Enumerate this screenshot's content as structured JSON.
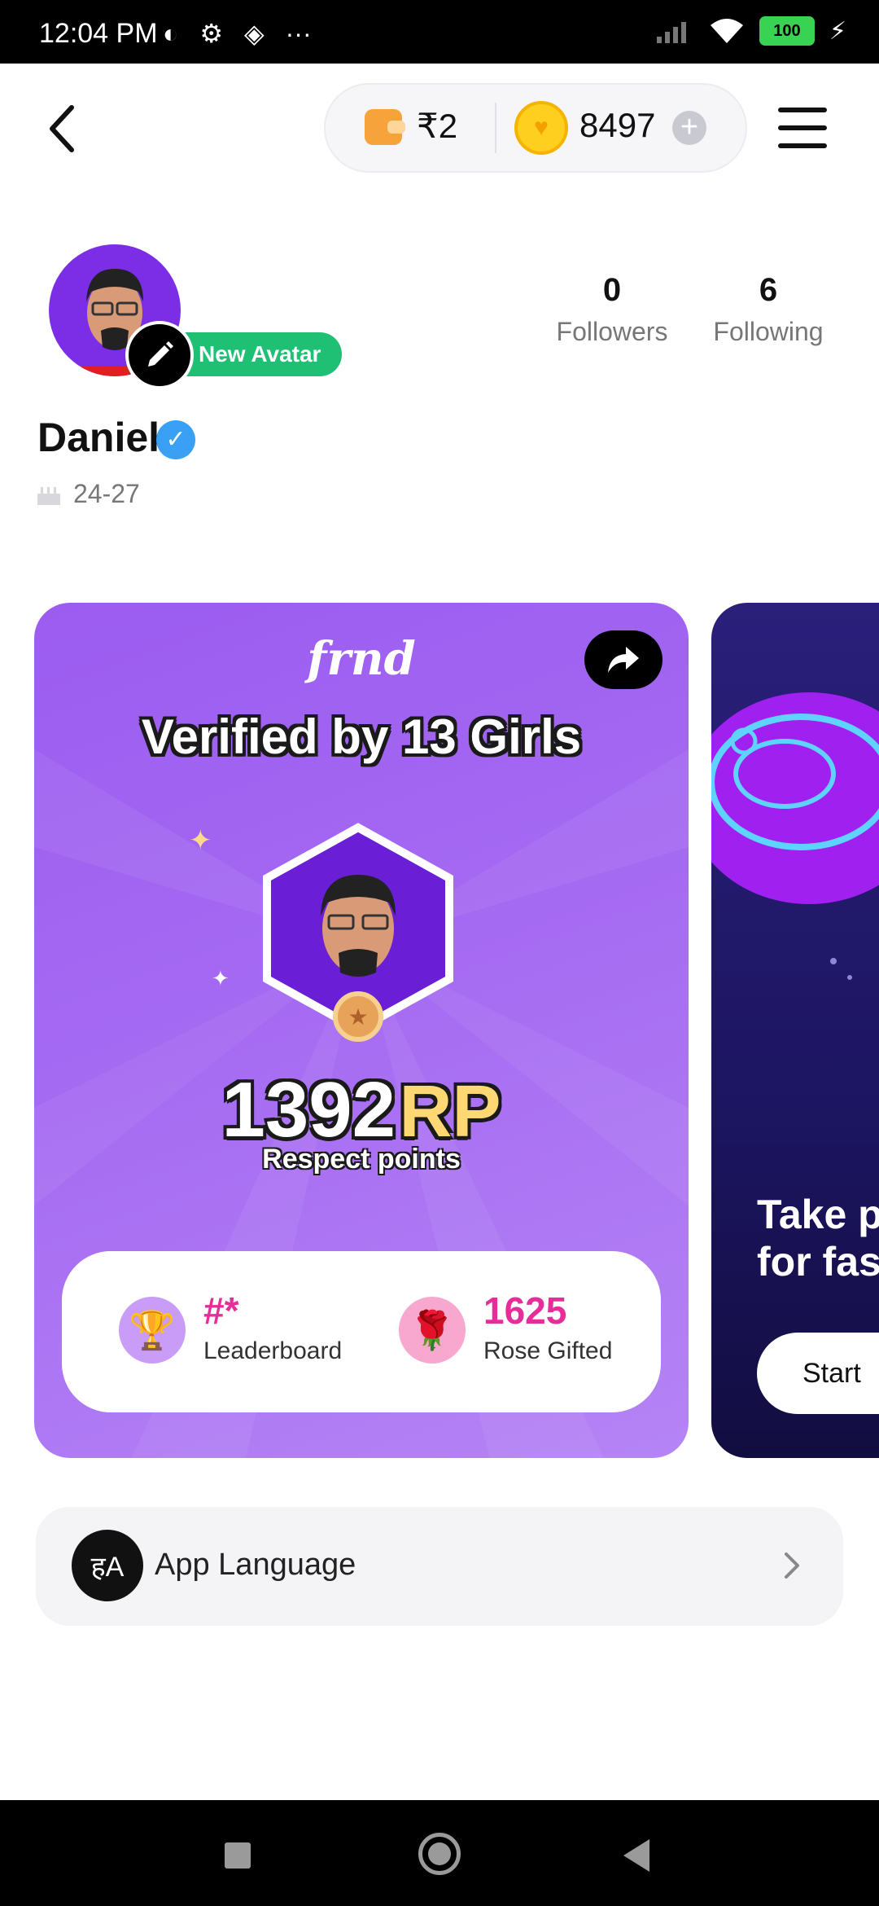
{
  "status_bar": {
    "time": "12:04 PM",
    "battery": "100"
  },
  "header": {
    "wallet_amount": "₹2",
    "coin_amount": "8497",
    "plus_symbol": "+"
  },
  "profile": {
    "new_avatar_label": "New Avatar",
    "followers_count": "0",
    "followers_label": "Followers",
    "following_count": "6",
    "following_label": "Following",
    "name": "Daniel",
    "age_range": "24-27"
  },
  "card": {
    "brand": "frnd",
    "title": "Verified by 13 Girls",
    "rp_value": "1392",
    "rp_unit": "RP",
    "rp_subtitle": "Respect points",
    "leaderboard_value": "#*",
    "leaderboard_label": "Leaderboard",
    "rose_value": "1625",
    "rose_label": "Rose Gifted",
    "accent_color": "#e62e9b"
  },
  "card2": {
    "title_line1": "Take pe",
    "title_line2": "for fast",
    "start_label": "Start"
  },
  "settings": {
    "app_language_label": "App Language",
    "app_language_icon_text": "हA"
  }
}
